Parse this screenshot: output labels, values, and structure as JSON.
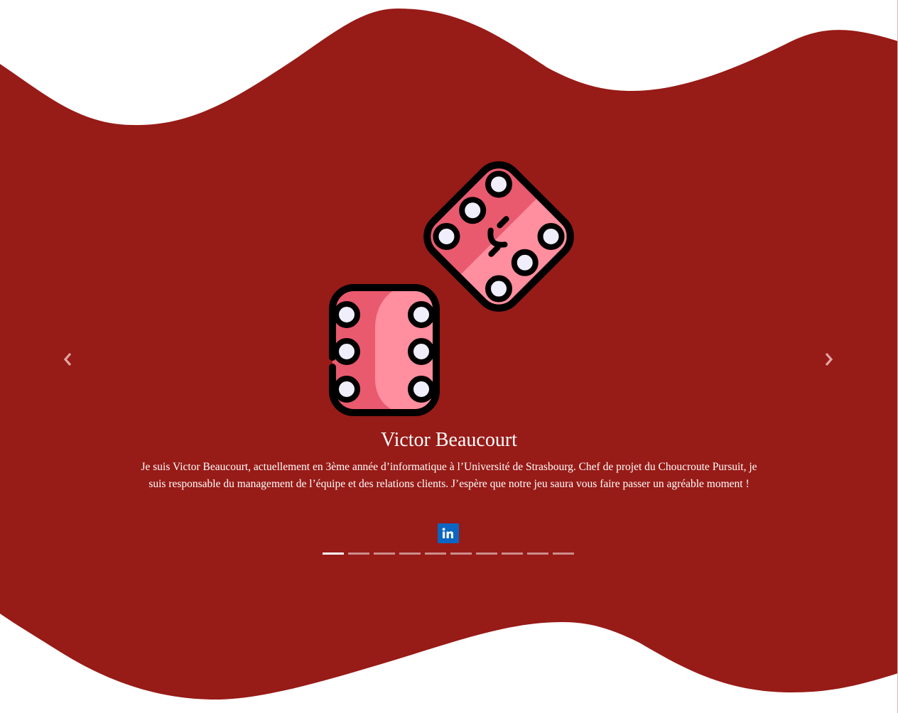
{
  "colors": {
    "background": "#ffffff",
    "wave": "#971b17",
    "text": "#ffffff",
    "linkedin": "#0a66c2",
    "dice_main": "#ff8e9e",
    "dice_shade": "#e95a6f",
    "pip": "#efeefa",
    "outline": "#000000"
  },
  "carousel": {
    "slide": {
      "image_icon": "dice-icon",
      "name": "Victor Beaucourt",
      "bio": "Je suis Victor Beaucourt, actuellement en 3ème année d’informatique à l’Université de Strasbourg. Chef de projet du Choucroute Pursuit, je suis responsable du management de l’équipe et des relations clients. J’espère que notre jeu saura vous faire passer un agréable moment !",
      "social_icon": "linkedin-icon"
    },
    "indicator_count": 10,
    "active_index": 0,
    "prev_icon": "chevron-left-icon",
    "next_icon": "chevron-right-icon"
  }
}
